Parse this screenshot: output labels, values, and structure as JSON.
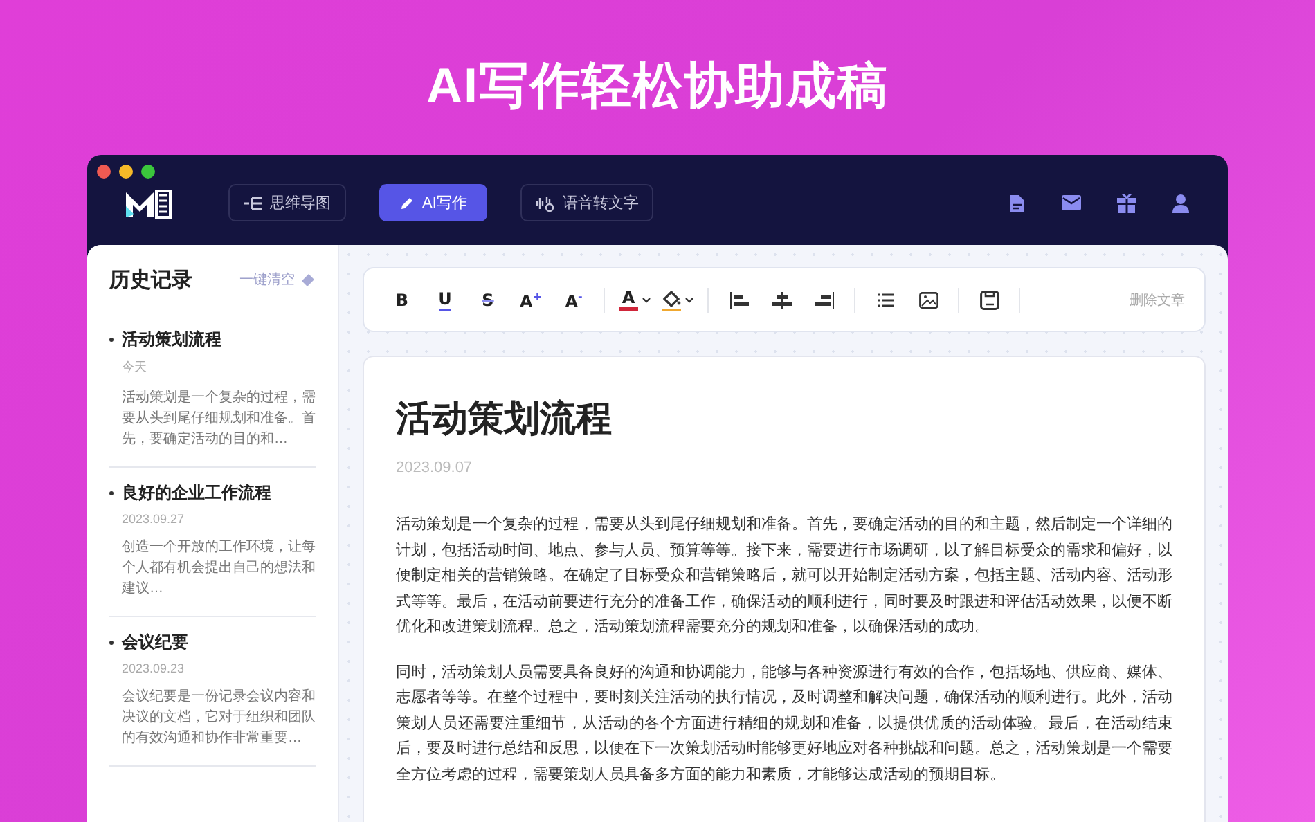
{
  "headline": "AI写作轻松协助成稿",
  "nav": [
    {
      "label": "思维导图",
      "kind": "mindmap",
      "selected": false
    },
    {
      "label": "AI写作",
      "kind": "pen",
      "selected": true
    },
    {
      "label": "语音转文字",
      "kind": "voice",
      "selected": false
    }
  ],
  "sidebar": {
    "title": "历史记录",
    "clear_label": "一键清空",
    "items": [
      {
        "title": "活动策划流程",
        "date": "今天",
        "snippet": "活动策划是一个复杂的过程，需要从头到尾仔细规划和准备。首先，要确定活动的目的和…"
      },
      {
        "title": "良好的企业工作流程",
        "date": "2023.09.27",
        "snippet": "创造一个开放的工作环境，让每个人都有机会提出自己的想法和建议…"
      },
      {
        "title": "会议纪要",
        "date": "2023.09.23",
        "snippet": "会议纪要是一份记录会议内容和决议的文档，它对于组织和团队的有效沟通和协作非常重要…"
      }
    ]
  },
  "toolbar": [
    [
      {
        "kind": "bold",
        "label": "B"
      },
      {
        "kind": "underline",
        "label": "U"
      },
      {
        "kind": "strike",
        "label": "S"
      },
      {
        "kind": "grow",
        "label": "A$^{+}$"
      },
      {
        "kind": "shrink",
        "label": "A$^{-}$"
      }
    ],
    [
      {
        "kind": "font-color",
        "label": "A",
        "color": "#d0263a"
      },
      {
        "kind": "fill-color",
        "color": "#f0a830"
      }
    ],
    [
      {
        "kind": "align-left"
      },
      {
        "kind": "align-center"
      },
      {
        "kind": "align-right"
      }
    ],
    [
      {
        "kind": "list"
      },
      {
        "kind": "image"
      }
    ],
    [
      {
        "kind": "save"
      }
    ]
  ],
  "delete_label": "删除文章",
  "document": {
    "title": "活动策划流程",
    "date": "2023.09.07",
    "paragraphs": [
      "活动策划是一个复杂的过程，需要从头到尾仔细规划和准备。首先，要确定活动的目的和主题，然后制定一个详细的计划，包括活动时间、地点、参与人员、预算等等。接下来，需要进行市场调研，以了解目标受众的需求和偏好，以便制定相关的营销策略。在确定了目标受众和营销策略后，就可以开始制定活动方案，包括主题、活动内容、活动形式等等。最后，在活动前要进行充分的准备工作，确保活动的顺利进行，同时要及时跟进和评估活动效果，以便不断优化和改进策划流程。总之，活动策划流程需要充分的规划和准备，以确保活动的成功。",
      "同时，活动策划人员需要具备良好的沟通和协调能力，能够与各种资源进行有效的合作，包括场地、供应商、媒体、志愿者等等。在整个过程中，要时刻关注活动的执行情况，及时调整和解决问题，确保活动的顺利进行。此外，活动策划人员还需要注重细节，从活动的各个方面进行精细的规划和准备，以提供优质的活动体验。最后，在活动结束后，要及时进行总结和反思，以便在下一次策划活动时能够更好地应对各种挑战和问题。总之，活动策划是一个需要全方位考虑的过程，需要策划人员具备多方面的能力和素质，才能够达成活动的预期目标。"
    ]
  }
}
